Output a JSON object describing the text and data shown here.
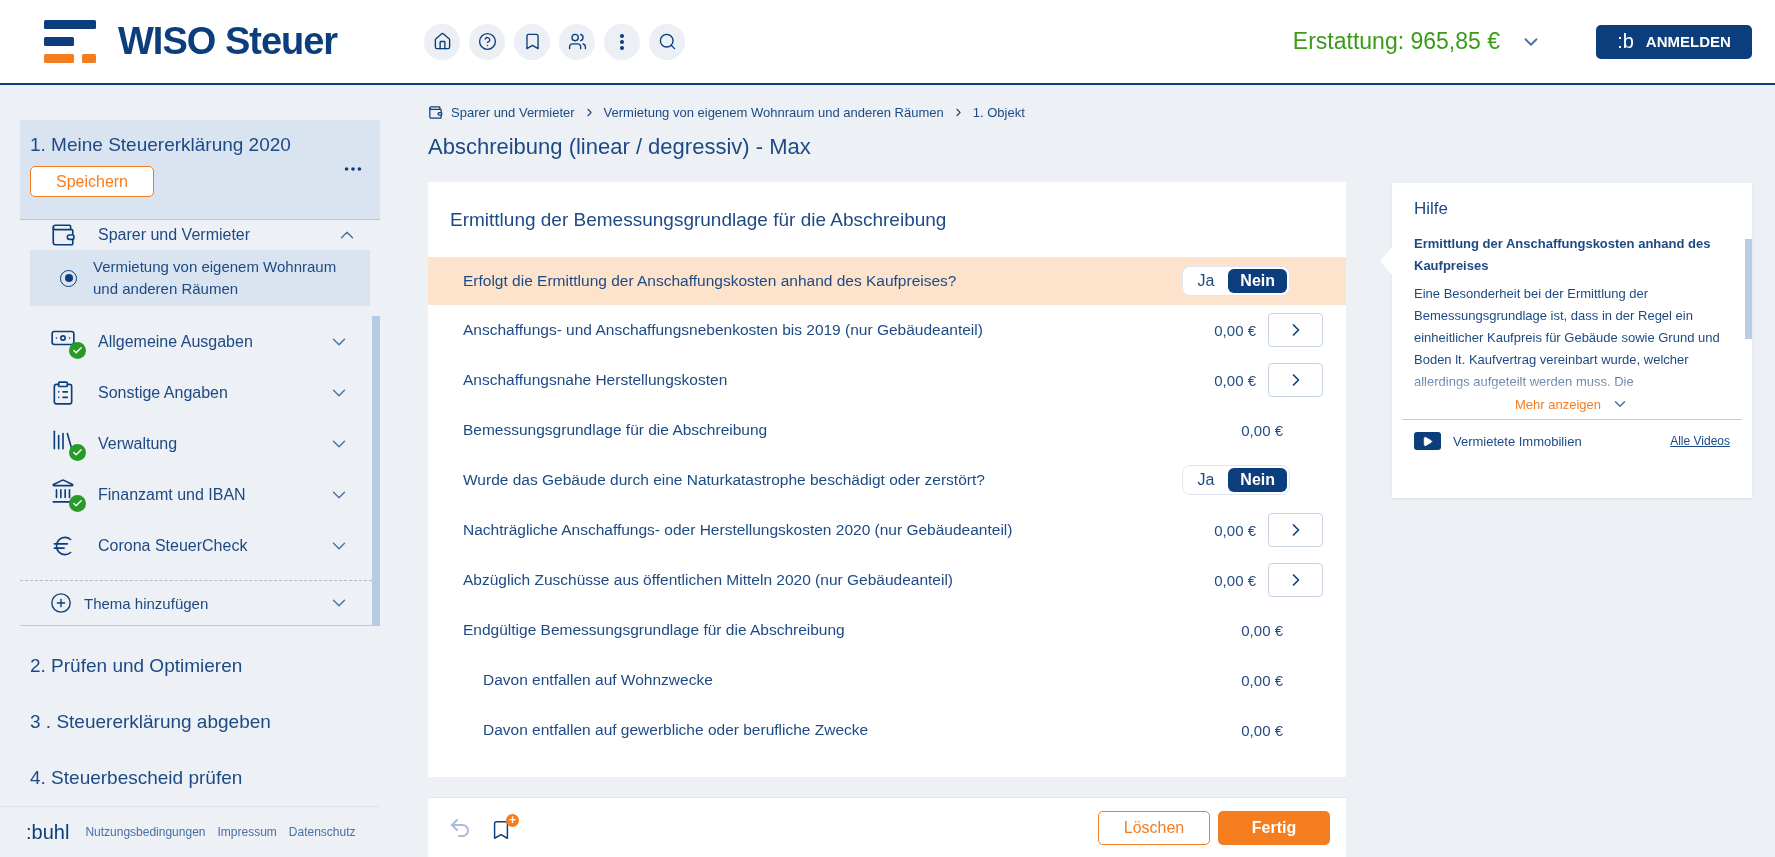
{
  "header": {
    "logo_text": "WISO Steuer",
    "refund": {
      "label": "Erstattung:",
      "amount": "965,85 €"
    },
    "login": {
      "mark": ":b",
      "label": "ANMELDEN"
    }
  },
  "sidebar": {
    "section": {
      "title": "1. Meine Steuererklärung 2020",
      "save_label": "Speichern"
    },
    "topics": [
      {
        "kind": "savings",
        "label": "Sparer und Vermieter",
        "done": false,
        "expanded": true,
        "children": [
          {
            "label": "Vermietung von eigenem Wohnraum und anderen Räumen",
            "selected": true
          }
        ]
      },
      {
        "kind": "money",
        "label": "Allgemeine Ausgaben",
        "done": true,
        "expanded": false
      },
      {
        "kind": "clipboard",
        "label": "Sonstige Angaben",
        "done": false,
        "expanded": false
      },
      {
        "kind": "binders",
        "label": "Verwaltung",
        "done": true,
        "expanded": false
      },
      {
        "kind": "bank",
        "label": "Finanzamt und IBAN",
        "done": true,
        "expanded": false
      },
      {
        "kind": "euro",
        "label": "Corona SteuerCheck",
        "done": false,
        "expanded": false
      }
    ],
    "add_topic": "Thema hinzufügen",
    "steps": [
      "2. Prüfen und Optimieren",
      "3 . Steuererklärung abgeben",
      "4. Steuerbescheid prüfen"
    ],
    "footer": {
      "brand": ":buhl",
      "links": [
        "Nutzungsbedingungen",
        "Impressum",
        "Datenschutz"
      ]
    }
  },
  "breadcrumb": [
    "Sparer und Vermieter",
    "Vermietung von eigenem Wohnraum und anderen Räumen",
    "1. Objekt"
  ],
  "page_title": "Abschreibung (linear / degressiv) - Max",
  "form": {
    "title": "Ermittlung der Bemessungsgrundlage für die Abschreibung",
    "rows": [
      {
        "kind": "toggle",
        "label": "Erfolgt die Ermittlung der Anschaffungskosten anhand des Kaufpreises?",
        "highlighted": true,
        "options": [
          {
            "label": "Ja",
            "selected": false
          },
          {
            "label": "Nein",
            "selected": true
          }
        ]
      },
      {
        "kind": "input",
        "label": "Anschaffungs- und Anschaffungsnebenkosten bis 2019 (nur Gebäudeanteil)",
        "highlighted": false,
        "value": "0,00 €"
      },
      {
        "kind": "input",
        "label": "Anschaffungsnahe Herstellungskosten",
        "highlighted": false,
        "value": "0,00 €"
      },
      {
        "kind": "value",
        "label": "Bemessungsgrundlage für die Abschreibung",
        "highlighted": false,
        "value": "0,00 €"
      },
      {
        "kind": "toggle",
        "label": "Wurde das Gebäude durch eine Naturkatastrophe beschädigt oder zerstört?",
        "highlighted": false,
        "options": [
          {
            "label": "Ja",
            "selected": false
          },
          {
            "label": "Nein",
            "selected": true
          }
        ]
      },
      {
        "kind": "input",
        "label": "Nachträgliche Anschaffungs- oder Herstellungskosten 2020 (nur Gebäudeanteil)",
        "highlighted": false,
        "value": "0,00 €"
      },
      {
        "kind": "input",
        "label": "Abzüglich Zuschüsse aus öffentlichen Mitteln 2020 (nur Gebäudeanteil)",
        "highlighted": false,
        "value": "0,00 €"
      },
      {
        "kind": "value",
        "label": "Endgültige Bemessungsgrundlage für die Abschreibung",
        "highlighted": false,
        "value": "0,00 €",
        "children": [
          {
            "kind": "value",
            "label": "Davon entfallen auf Wohnzwecke",
            "highlighted": false,
            "value": "0,00 €"
          },
          {
            "kind": "value",
            "label": "Davon entfallen auf gewerbliche oder berufliche Zwecke",
            "highlighted": false,
            "value": "0,00 €"
          }
        ]
      }
    ]
  },
  "help": {
    "title": "Hilfe",
    "heading": "Ermittlung der Anschaffungskosten anhand des Kaufpreises",
    "text": "Eine Besonderheit bei der Ermittlung der Bemessungsgrundlage ist, dass in der Regel ein einheitlicher Kaufpreis für Gebäude sowie Grund und Boden lt. Kaufvertrag vereinbart wurde, welcher allerdings aufgeteilt werden muss. Die",
    "more": "Mehr anzeigen",
    "video": "Vermietete Immobilien",
    "all_videos": "Alle Videos"
  },
  "actions": {
    "delete": "Löschen",
    "done": "Fertig",
    "bookmark_badge": "+"
  }
}
